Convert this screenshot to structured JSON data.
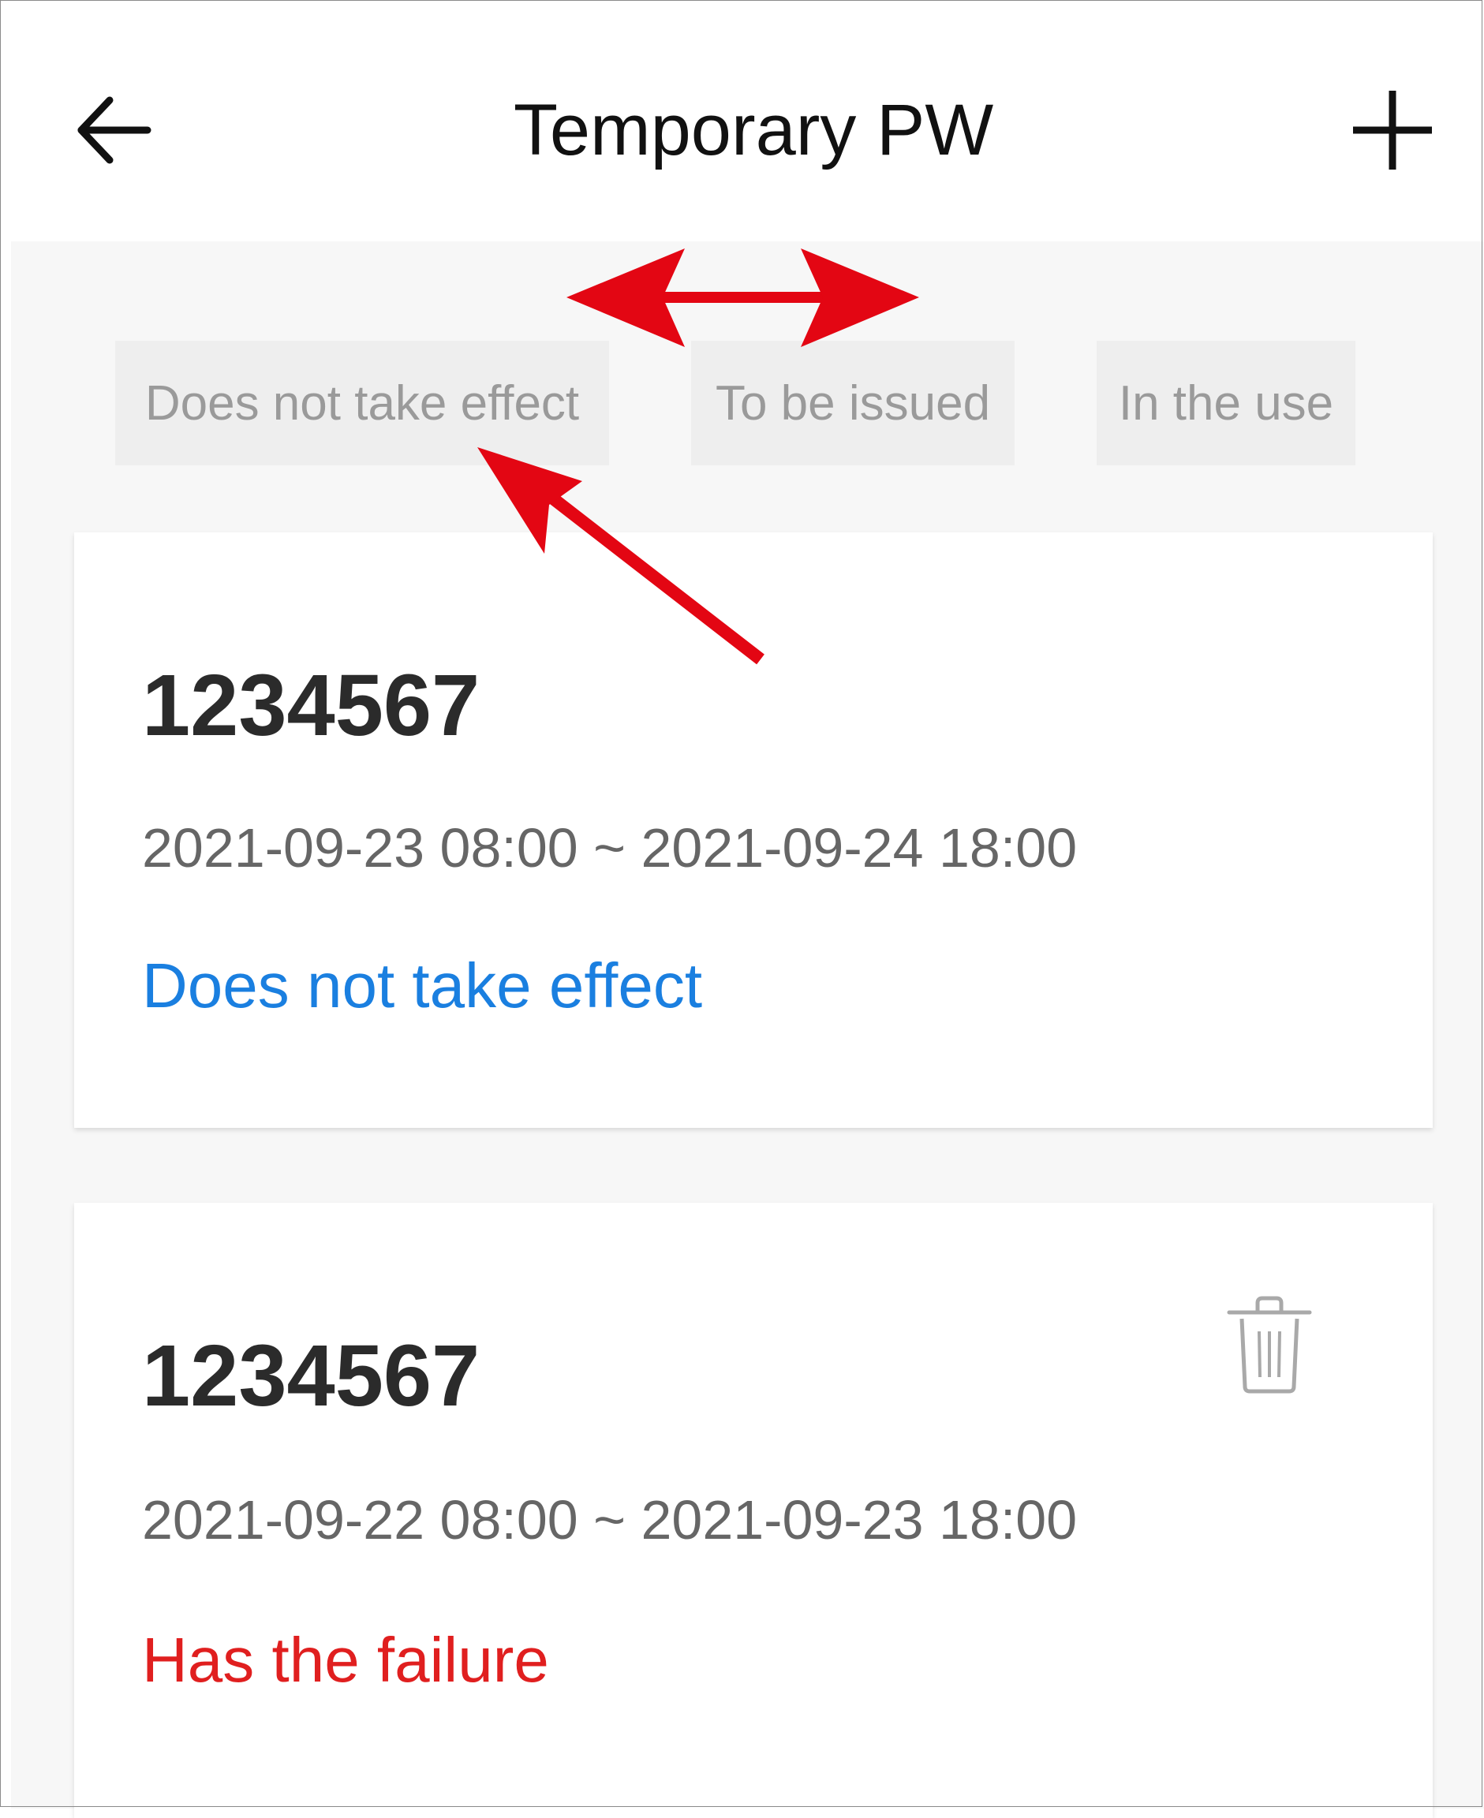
{
  "header": {
    "title": "Temporary PW",
    "back_icon": "arrow-left-icon",
    "add_icon": "plus-icon"
  },
  "tabs": [
    {
      "label": "Does not take effect"
    },
    {
      "label": "To be issued"
    },
    {
      "label": "In the use"
    }
  ],
  "passwords": [
    {
      "code": "1234567",
      "range": "2021-09-23 08:00 ~ 2021-09-24 18:00",
      "status": "Does not take effect",
      "status_color": "#1a7fe0"
    },
    {
      "code": "1234567",
      "range": "2021-09-22 08:00 ~ 2021-09-23 18:00",
      "status": "Has the failure",
      "status_color": "#e01f1f",
      "delete_icon": "trash-icon"
    }
  ],
  "annotation_color": "#e30613"
}
